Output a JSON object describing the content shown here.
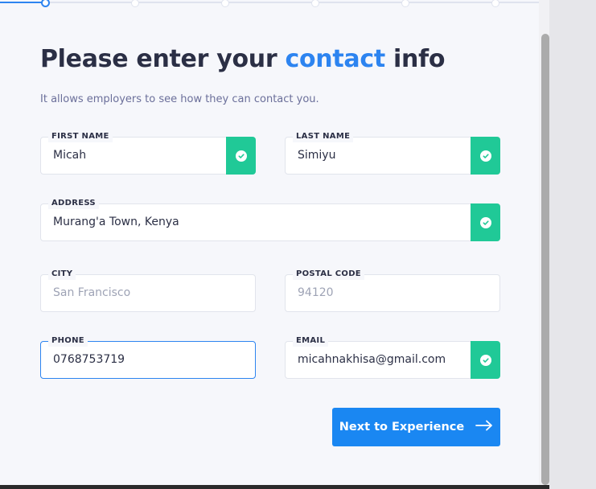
{
  "title": {
    "prefix": "Please enter your ",
    "accent": "contact",
    "suffix": " info"
  },
  "subtitle": "It allows employers to see how they can contact you.",
  "fields": {
    "first_name": {
      "label": "FIRST NAME",
      "value": "Micah",
      "valid": true
    },
    "last_name": {
      "label": "LAST NAME",
      "value": "Simiyu",
      "valid": true
    },
    "address": {
      "label": "ADDRESS",
      "value": "Murang'a Town, Kenya",
      "valid": true
    },
    "city": {
      "label": "CITY",
      "placeholder": "San Francisco"
    },
    "postal_code": {
      "label": "POSTAL CODE",
      "placeholder": "94120"
    },
    "phone": {
      "label": "PHONE",
      "value": "0768753719",
      "focused": true
    },
    "email": {
      "label": "EMAIL",
      "value": "micahnakhisa@gmail.com",
      "valid": true
    }
  },
  "next_button": {
    "label": "Next to Experience",
    "icon": "arrow-right-icon"
  },
  "progress": {
    "current_step": 1,
    "total_steps_visible": 6
  },
  "colors": {
    "accent": "#2d84f0",
    "button": "#1a87f2",
    "valid": "#20c997",
    "text": "#2b2f45",
    "muted": "#6b6f9a"
  }
}
